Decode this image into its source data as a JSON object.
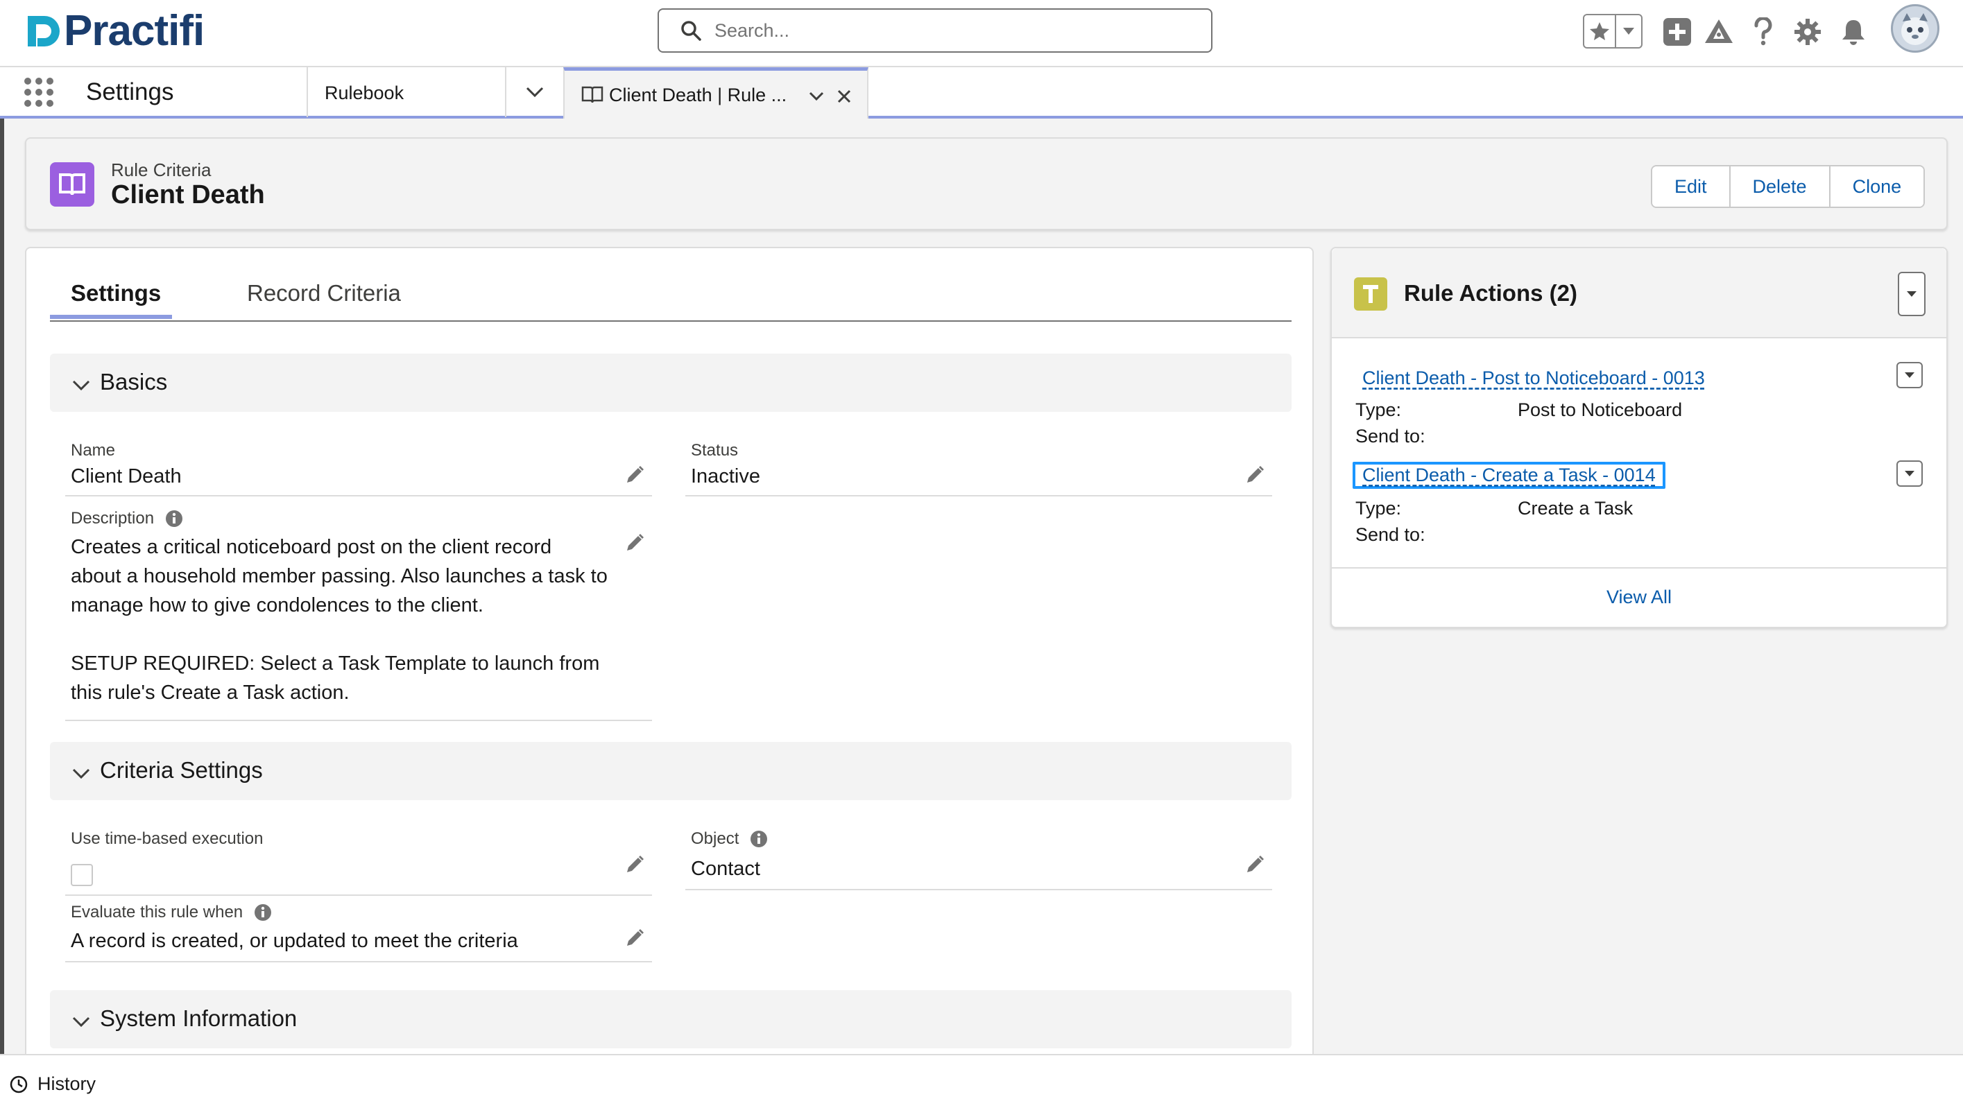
{
  "header": {
    "logo_text": "Practifi",
    "search_placeholder": "Search..."
  },
  "nav": {
    "app_name": "Settings",
    "item_label": "Rulebook",
    "tab_label": "Client Death | Rule ..."
  },
  "record": {
    "type_label": "Rule Criteria",
    "title": "Client Death",
    "actions": {
      "edit": "Edit",
      "delete": "Delete",
      "clone": "Clone"
    }
  },
  "tabs": {
    "settings": "Settings",
    "record_criteria": "Record Criteria"
  },
  "basics": {
    "title": "Basics",
    "name_label": "Name",
    "name_value": "Client Death",
    "status_label": "Status",
    "status_value": "Inactive",
    "description_label": "Description",
    "description_lines": [
      "Creates a critical noticeboard post on the client record",
      "about a household member passing. Also launches a task to",
      "manage how to give condolences to the client.",
      "",
      "SETUP REQUIRED: Select a Task Template to launch from",
      "this rule's Create a Task action."
    ]
  },
  "criteria": {
    "title": "Criteria Settings",
    "time_label": "Use time-based execution",
    "time_checked": false,
    "object_label": "Object",
    "object_value": "Contact",
    "evaluate_label": "Evaluate this rule when",
    "evaluate_value": "A record is created, or updated to meet the criteria"
  },
  "system": {
    "title": "System Information"
  },
  "rule_actions": {
    "title": "Rule Actions (2)",
    "items": [
      {
        "name": "Client Death - Post to Noticeboard - 0013",
        "type_label": "Type:",
        "type_value": "Post to Noticeboard",
        "send_label": "Send to:"
      },
      {
        "name": "Client Death - Create a Task - 0014",
        "type_label": "Type:",
        "type_value": "Create a Task",
        "send_label": "Send to:"
      }
    ],
    "view_all": "View All"
  },
  "utility": {
    "history": "History"
  },
  "colors": {
    "brand": "#1b3d6d",
    "accent": "#8c9be0",
    "link": "#0b5cab",
    "record_icon": "#9b5fe0",
    "action_icon": "#c8c24a",
    "focus": "#1b96ff"
  }
}
